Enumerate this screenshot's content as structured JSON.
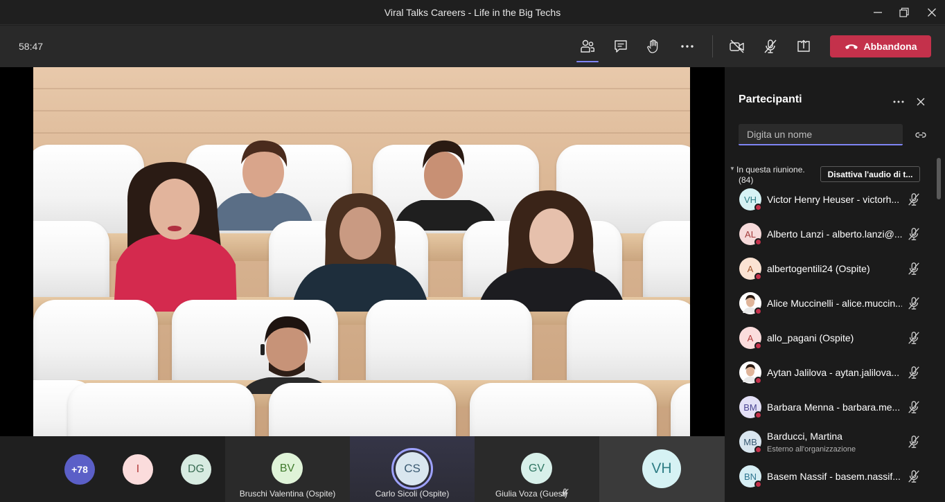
{
  "window": {
    "title": "Viral Talks Careers - Life in the Big Techs"
  },
  "toolbar": {
    "timer": "58:47",
    "leave_label": "Abbandona",
    "leave_color": "#c4314b",
    "icons": [
      "participants-icon",
      "chat-icon",
      "raise-hand-icon",
      "more-icon",
      "camera-off-icon",
      "mic-off-icon",
      "share-screen-icon"
    ]
  },
  "strip": {
    "overflow_count": "+78",
    "tiles": [
      {
        "initials": "I",
        "label": ""
      },
      {
        "initials": "DG",
        "label": ""
      },
      {
        "initials": "BV",
        "label": "Bruschi Valentina (Ospite)"
      },
      {
        "initials": "CS",
        "label": "Carlo Sicoli (Ospite)"
      },
      {
        "initials": "GV",
        "label": "Giulia Voza (Guest)"
      },
      {
        "initials": "VH",
        "label": ""
      }
    ]
  },
  "panel": {
    "title": "Partecipanti",
    "search_placeholder": "Digita un nome",
    "section_label": "In questa riunione.",
    "section_count": "(84)",
    "mute_all_label": "Disattiva l'audio di t...",
    "participants": [
      {
        "initials": "VH",
        "name": "Victor Henry Heuser - victorh...",
        "sub": "",
        "avatar_bg": "#d6f2f4",
        "avatar_fg": "#2e7d85"
      },
      {
        "initials": "AL",
        "name": "Alberto Lanzi - alberto.lanzi@...",
        "sub": "",
        "avatar_bg": "#f6dada",
        "avatar_fg": "#a33a3a"
      },
      {
        "initials": "A",
        "name": "albertogentili24 (Ospite)",
        "sub": "",
        "avatar_bg": "#fbe3d3",
        "avatar_fg": "#a2562c"
      },
      {
        "initials": "",
        "name": "Alice Muccinelli - alice.muccin...",
        "sub": "",
        "avatar_bg": "#8a6a5a",
        "avatar_fg": "#ffffff"
      },
      {
        "initials": "A",
        "name": "allo_pagani (Ospite)",
        "sub": "",
        "avatar_bg": "#fbdcdc",
        "avatar_fg": "#b23a3a"
      },
      {
        "initials": "",
        "name": "Aytan Jalilova - aytan.jalilova...",
        "sub": "",
        "avatar_bg": "#4a3a33",
        "avatar_fg": "#ffffff"
      },
      {
        "initials": "BM",
        "name": "Barbara Menna - barbara.me...",
        "sub": "",
        "avatar_bg": "#e3e0f6",
        "avatar_fg": "#4b4593"
      },
      {
        "initials": "MB",
        "name": "Barducci, Martina",
        "sub": "Esterno all'organizzazione",
        "avatar_bg": "#d9e6ef",
        "avatar_fg": "#3a5a72"
      },
      {
        "initials": "BN",
        "name": "Basem Nassif - basem.nassif...",
        "sub": "",
        "avatar_bg": "#d6eef4",
        "avatar_fg": "#2e7590"
      }
    ]
  }
}
